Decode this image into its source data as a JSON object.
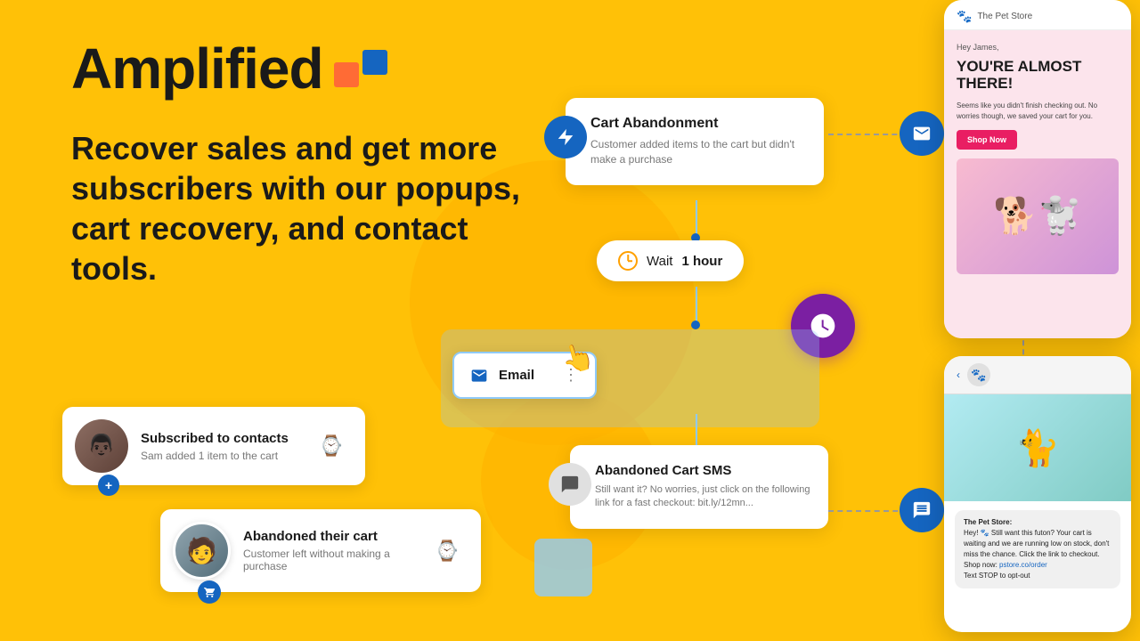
{
  "brand": {
    "name": "Amplified"
  },
  "hero": {
    "text": "Recover sales and get more subscribers with our popups, cart recovery, and contact tools."
  },
  "flow": {
    "cart_card": {
      "title": "Cart Abandonment",
      "desc": "Customer added items to the cart but didn't make a purchase"
    },
    "wait_pill": {
      "label_pre": "Wait ",
      "label_bold": "1 hour"
    },
    "email_card": {
      "label": "Email"
    },
    "sms_card": {
      "title": "Abandoned Cart SMS",
      "desc": "Still want it? No worries, just click on the following link for a fast checkout: bit.ly/12mn..."
    }
  },
  "notifications": {
    "subscribed": {
      "title": "Subscribed to contacts",
      "sub": "Sam added 1 item to the cart",
      "product_emoji": "⌚"
    },
    "abandoned": {
      "title": "Abandoned their cart",
      "sub": "Customer left without making a purchase",
      "product_emoji": "⌚"
    }
  },
  "phone_top": {
    "store": "The Pet Store",
    "greeting": "Hey James,",
    "headline": "YOU'RE ALMOST THERE!",
    "body": "Seems like you didn't finish checking out. No worries though, we saved your cart for you.",
    "button": "Shop Now"
  },
  "phone_bottom": {
    "store": "The Pet Store:",
    "message": "Hey! 🐾 Still want this futon? Your cart is waiting and we are running low on stock, don't miss the chance. Click the link to checkout.\nShop now: pstore.co/order\nText STOP to opt-out"
  }
}
